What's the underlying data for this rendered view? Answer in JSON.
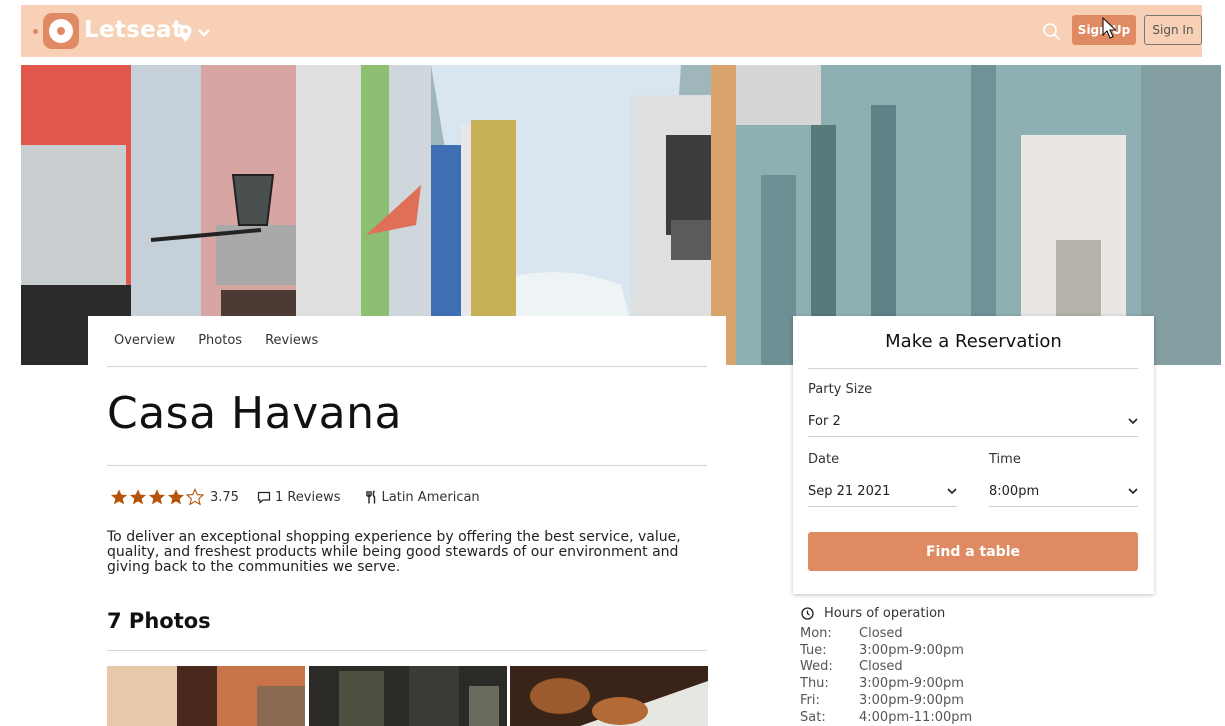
{
  "nav": {
    "brand": "Letseat",
    "signup_label": "Sign Up",
    "signin_label": "Sign In"
  },
  "tabs": [
    "Overview",
    "Photos",
    "Reviews"
  ],
  "restaurant": {
    "name": "Casa Havana",
    "rating": 3.75,
    "rating_label": "3.75",
    "reviews_label": "1 Reviews",
    "cuisine": "Latin American",
    "description": "To deliver an exceptional shopping experience by offering the best service, value, quality, and freshest products while being good stewards of our environment and giving back to the communities we serve."
  },
  "photos": {
    "title": "7 Photos"
  },
  "reservation": {
    "title": "Make a Reservation",
    "party_label": "Party Size",
    "party_value": "For 2",
    "date_label": "Date",
    "date_value": "Sep 21 2021",
    "time_label": "Time",
    "time_value": "8:00pm",
    "button_label": "Find a table"
  },
  "hours": {
    "title": "Hours of operation",
    "rows": [
      {
        "day": "Mon:",
        "time": "Closed"
      },
      {
        "day": "Tue:",
        "time": "3:00pm-9:00pm"
      },
      {
        "day": "Wed:",
        "time": "Closed"
      },
      {
        "day": "Thu:",
        "time": "3:00pm-9:00pm"
      },
      {
        "day": "Fri:",
        "time": "3:00pm-9:00pm"
      },
      {
        "day": "Sat:",
        "time": "4:00pm-11:00pm"
      }
    ]
  },
  "colors": {
    "accent": "#e08a63",
    "nav_bg": "#f7d0b6",
    "star": "#b45309"
  },
  "icons": [
    "logo-icon",
    "location-pin-icon",
    "chevron-down-icon",
    "search-icon",
    "star-icon",
    "comment-icon",
    "utensils-icon",
    "clock-icon",
    "mouse-cursor-icon"
  ]
}
